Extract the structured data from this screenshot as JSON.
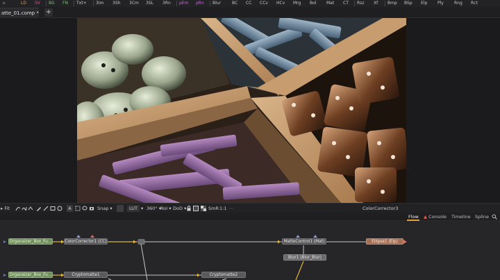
{
  "toolbar": {
    "buttons": [
      "LD",
      "SV",
      "BG",
      "FN",
      "Txt+",
      "3Im",
      "3Sh",
      "3Cm",
      "3SL",
      "3Rn",
      "pEm",
      "pRn",
      "Blur",
      "BC",
      "CC",
      "CCv",
      "HCv",
      "Mrg",
      "Bol",
      "Mat",
      "CT",
      "Rsz",
      "Xf",
      "Bmp",
      "BSp",
      "Elp",
      "Ply",
      "Rng",
      "Rct"
    ],
    "colors": {
      "LD": "#e6a050",
      "SV": "#e05a9a",
      "BG": "#6fc86f",
      "FN": "#6fc86f",
      "Txt+": "#cfcfcf",
      "pEm": "#c96bd6",
      "pRn": "#c96bd6"
    }
  },
  "tabbar": {
    "comp_tab": "atte_01.comp *",
    "add_tab": "+"
  },
  "viewer": {
    "image_alt": "Wooden box compartments with buttons, clothespins and dice"
  },
  "viewer_controls": {
    "fit": "Fit",
    "snap": "Snap",
    "lut": "LUT",
    "angle": "360°",
    "roi": "RoI",
    "dod": "DoD",
    "smr": "SmR",
    "ratio": "1:1",
    "node_name": "ColorCorrector3"
  },
  "flow_tabs": {
    "flow": "Flow",
    "console": "Console",
    "timeline": "Timeline",
    "spline": "Spline"
  },
  "nodes": {
    "organaizer_1": "Organaizer_Box_Fu...",
    "colorcorrector1": "ColorCorrector1 (CC)",
    "mattecontrol1": "MatteControl1 (Mat)",
    "ellipse1": "Ellipse1 (Elp)",
    "blur1": "Blur1 (Blur_Blur)",
    "organaizer_2": "Organaizer_Box_Fu...",
    "cryptomatte1": "Cryptomatte1",
    "cryptomatte2": "Cryptomatte2"
  }
}
